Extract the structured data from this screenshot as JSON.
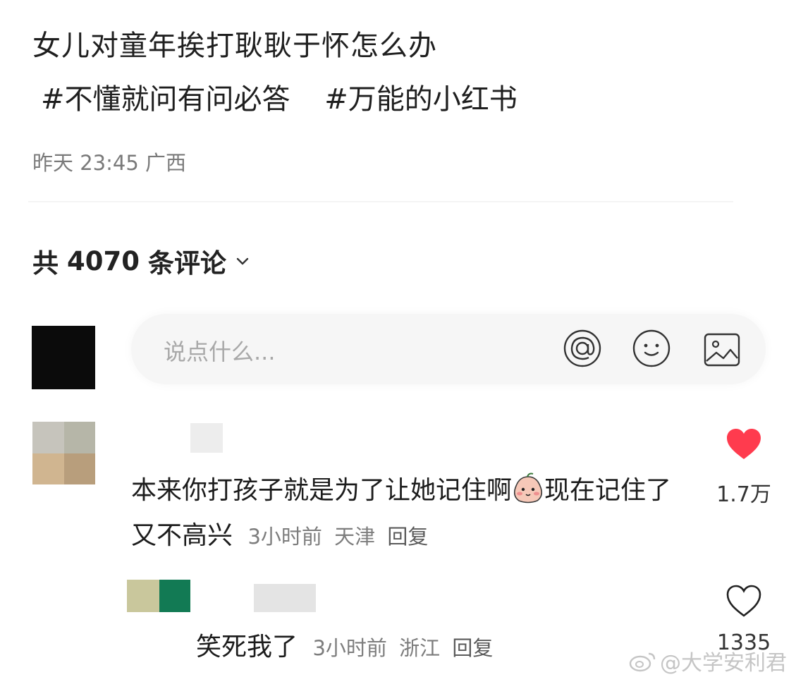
{
  "post": {
    "title": "女儿对童年挨打耿耿于怀怎么办",
    "hashtags": [
      "#不懂就问有问必答",
      "#万能的小红书"
    ],
    "time": "昨天 23:45",
    "location": "广西"
  },
  "comments_header": {
    "prefix": "共",
    "count": "4070",
    "suffix": "条评论"
  },
  "input": {
    "placeholder": "说点什么..."
  },
  "icons": {
    "mention": "at-icon",
    "emoji": "smiley-icon",
    "image": "image-icon",
    "like_filled": "heart-filled-icon",
    "like_outline": "heart-outline-icon",
    "sort": "chevron-down-icon"
  },
  "colors": {
    "like_red": "#ff3b4e",
    "meta_gray": "#7d7d7d"
  },
  "comments": [
    {
      "text_before_emoji": "本来你打孩子就是为了让她记住啊",
      "text_after_emoji": "现在记住了又不高兴",
      "time": "3小时前",
      "location": "天津",
      "reply_label": "回复",
      "likes": "1.7万",
      "liked": true
    },
    {
      "text": "笑死我了",
      "time": "3小时前",
      "location": "浙江",
      "reply_label": "回复",
      "likes": "1335",
      "liked": false
    }
  ],
  "watermark": "@大学安利君"
}
